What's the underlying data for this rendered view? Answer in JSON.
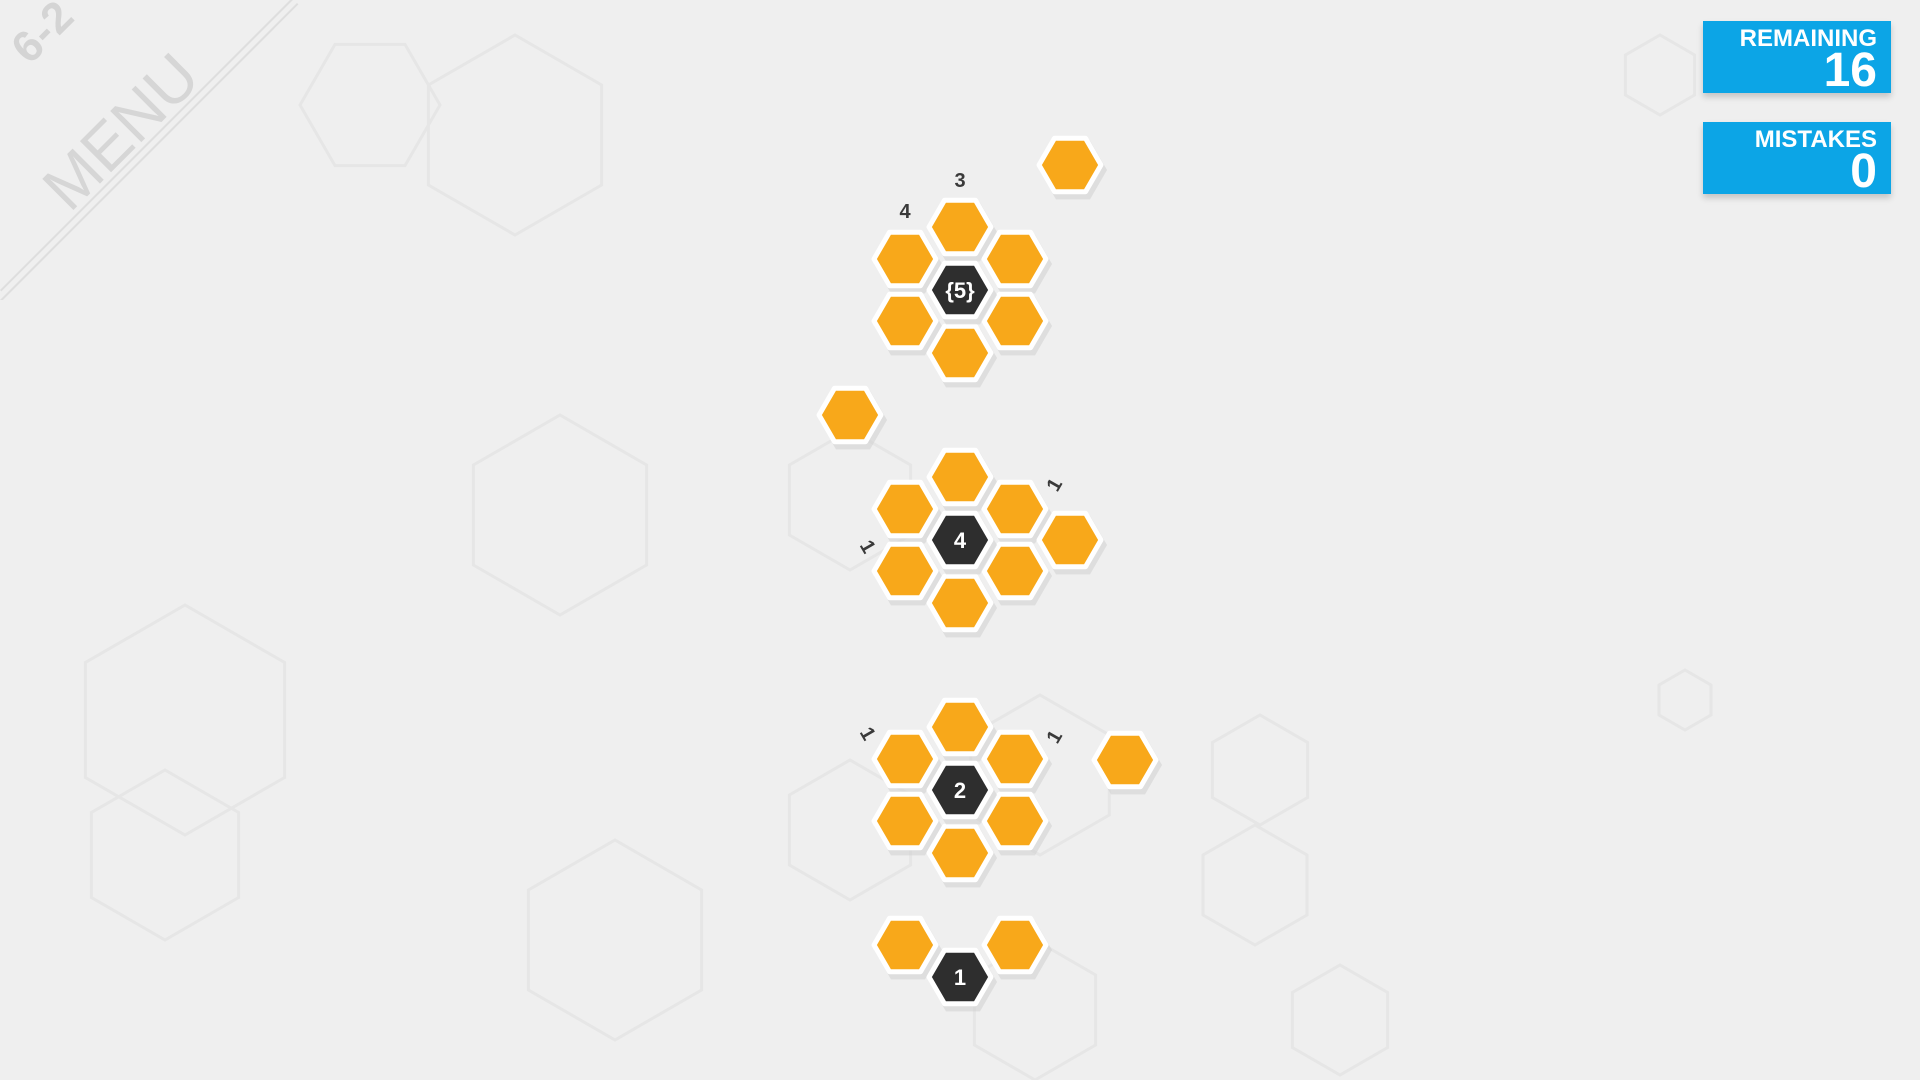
{
  "level": {
    "label": "6-2",
    "menu_label": "MENU"
  },
  "counters": {
    "remaining": {
      "label": "REMAINING",
      "value": "16"
    },
    "mistakes": {
      "label": "MISTAKES",
      "value": "0"
    }
  },
  "colors": {
    "unrevealed": "#f8a81a",
    "revealed": "#2e2e2e",
    "counter_bg": "#0ca5e6",
    "background": "#efefef"
  },
  "cells": [
    {
      "state": "unrevealed",
      "col": 0,
      "row": 0
    },
    {
      "state": "revealed",
      "col": 0,
      "row": 1,
      "text": ""
    },
    {
      "state": "unrevealed",
      "col": 1,
      "row": 1.5
    },
    {
      "state": "unrevealed",
      "col": 2,
      "row": 0
    },
    {
      "state": "revealed",
      "col": 2,
      "row": 1,
      "text": "{5}"
    },
    {
      "state": "unrevealed",
      "col": 2,
      "row": 2
    },
    {
      "state": "unrevealed",
      "col": 3,
      "row": 0.5
    },
    {
      "state": "unrevealed",
      "col": 3,
      "row": 1.5
    },
    {
      "state": "unrevealed",
      "col": 4,
      "row": -1
    }
  ],
  "clusters": [
    {
      "center": "{5}"
    },
    {
      "center": "4"
    },
    {
      "center": "2"
    },
    {
      "center": "1"
    }
  ],
  "hints": [
    {
      "text": "3"
    },
    {
      "text": "4"
    },
    {
      "text": "1"
    },
    {
      "text": "1"
    },
    {
      "text": "1"
    },
    {
      "text": "1"
    }
  ]
}
